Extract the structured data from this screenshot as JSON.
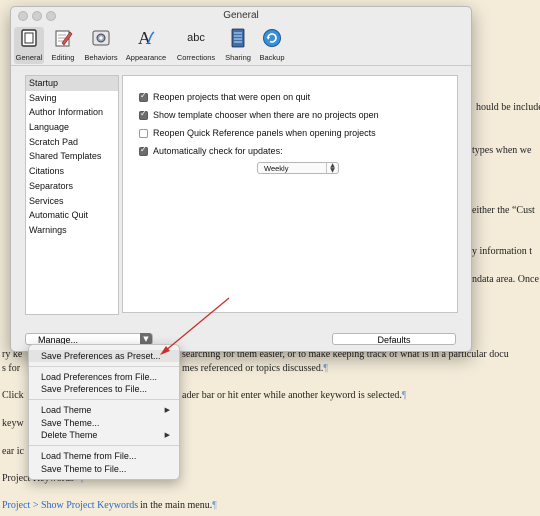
{
  "window": {
    "title": "General"
  },
  "toolbar": {
    "items": [
      {
        "label": "General",
        "icon": "general-icon",
        "active": true
      },
      {
        "label": "Editing",
        "icon": "pencil-icon"
      },
      {
        "label": "Behaviors",
        "icon": "gear-box-icon"
      },
      {
        "label": "Appearance",
        "icon": "font-a-icon"
      },
      {
        "label": "Corrections",
        "icon": "abc-icon",
        "icon_text": "abc"
      },
      {
        "label": "Sharing",
        "icon": "sharing-icon"
      },
      {
        "label": "Backup",
        "icon": "backup-icon"
      }
    ]
  },
  "categories": [
    {
      "label": "Startup",
      "selected": true
    },
    {
      "label": "Saving"
    },
    {
      "label": "Author Information"
    },
    {
      "label": "Language"
    },
    {
      "label": "Scratch Pad"
    },
    {
      "label": "Shared Templates"
    },
    {
      "label": "Citations"
    },
    {
      "label": "Separators"
    },
    {
      "label": "Services"
    },
    {
      "label": "Automatic Quit"
    },
    {
      "label": "Warnings"
    }
  ],
  "options": [
    {
      "label": "Reopen projects that were open on quit",
      "checked": true
    },
    {
      "label": "Show template chooser when there are no projects open",
      "checked": true
    },
    {
      "label": "Reopen Quick Reference panels when opening projects",
      "checked": false
    },
    {
      "label": "Automatically check for updates:",
      "checked": true
    }
  ],
  "update_frequency": {
    "value": "Weekly"
  },
  "buttons": {
    "manage": "Manage...",
    "defaults": "Defaults"
  },
  "manage_menu": {
    "items": [
      {
        "label": "Save Preferences as Preset...",
        "highlighted": true
      },
      {
        "label": "Load Preferences from File..."
      },
      {
        "label": "Save Preferences to File..."
      },
      {
        "label": "Load Theme",
        "submenu": true
      },
      {
        "label": "Save Theme..."
      },
      {
        "label": "Delete Theme",
        "submenu": true
      },
      {
        "label": "Load Theme from File..."
      },
      {
        "label": "Save Theme to File..."
      }
    ]
  },
  "background_doc": {
    "lines": [
      {
        "text": "hould be include"
      },
      {
        "text": "types when we"
      },
      {
        "text": "either the “Cust"
      },
      {
        "text": "y information t"
      },
      {
        "text": "ndata area. Once"
      },
      {
        "text": "ry ke"
      },
      {
        "text": "searching for them easier, or to make keeping track of what is in a particular docu"
      },
      {
        "text": "s for"
      },
      {
        "text": "mes referenced or topics discussed."
      },
      {
        "text": "Click"
      },
      {
        "text": "ader bar or hit enter while another keyword is selected."
      },
      {
        "text": "keyw"
      },
      {
        "text": "ear ic"
      },
      {
        "text": "Project Keywords"
      },
      {
        "text": "Project > Show Project Keywords"
      },
      {
        "text": "in the main menu."
      }
    ],
    "pilcrow": "¶",
    "chevron": "»"
  }
}
